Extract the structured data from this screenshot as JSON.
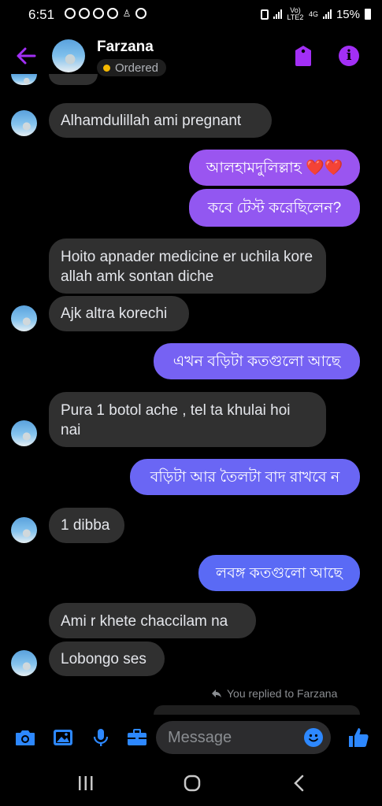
{
  "status_bar": {
    "time": "6:51",
    "network": "Vo) LTE2",
    "net_type": "4G",
    "battery": "15%"
  },
  "header": {
    "contact_name": "Farzana",
    "status_label": "Ordered"
  },
  "messages": [
    {
      "side": "in",
      "text": "Alhamdulillah ami pregnant"
    },
    {
      "side": "out",
      "text": "আলহামদুলিল্লাহ ❤️❤️"
    },
    {
      "side": "out",
      "text": "কবে টেস্ট করেছিলেন?"
    },
    {
      "side": "in",
      "text": "Hoito apnader medicine er uchila kore allah amk sontan diche"
    },
    {
      "side": "in",
      "text": "Ajk altra korechi"
    },
    {
      "side": "out",
      "text": "এখন বড়িটা কতগুলো আছে"
    },
    {
      "side": "in",
      "text": "Pura 1 botol ache , tel ta khulai hoi nai"
    },
    {
      "side": "out",
      "text": "বড়িটা আর তৈলটা বাদ রাখবে ন"
    },
    {
      "side": "in",
      "text": "1 dibba"
    },
    {
      "side": "out",
      "text": "লবঙ্গ কতগুলো আছে"
    },
    {
      "side": "in",
      "text": "Ami r khete chaccilam na"
    },
    {
      "side": "in",
      "text": "Lobongo ses"
    }
  ],
  "replied_note": "You replied to Farzana",
  "composer": {
    "placeholder": "Message"
  },
  "icons": [
    "back-arrow-icon",
    "tag-icon",
    "info-icon",
    "camera-icon",
    "gallery-icon",
    "microphone-icon",
    "briefcase-icon",
    "emoji-icon",
    "like-icon",
    "recent-apps-icon",
    "home-icon",
    "back-nav-icon"
  ],
  "colors": {
    "accent_purple": "#a22ff5",
    "out_bubble_top": "#9a55f0",
    "out_bubble_bottom": "#5a6af5",
    "in_bubble": "#303030",
    "composer_blue": "#2d88ff"
  }
}
